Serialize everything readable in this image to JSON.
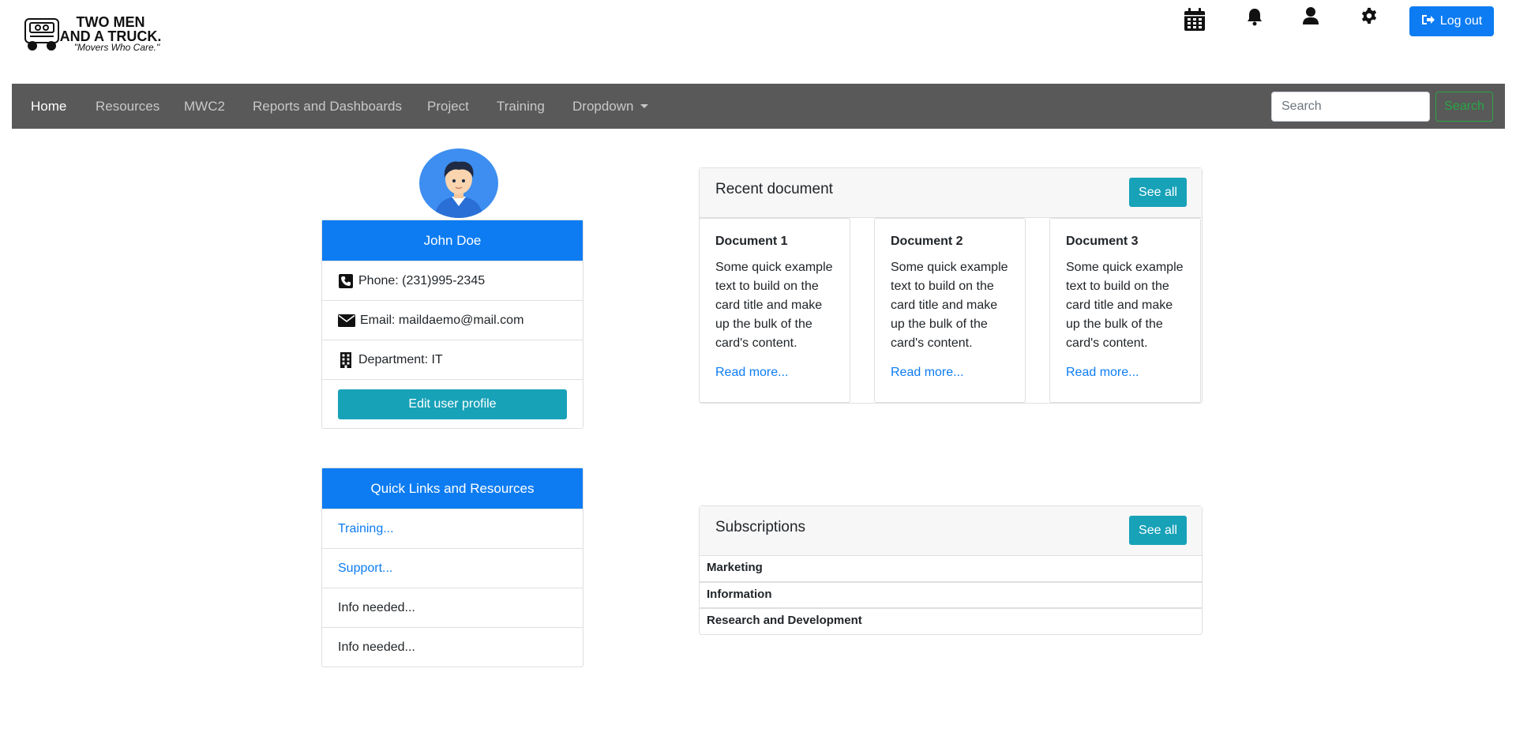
{
  "header": {
    "logo_line1": "TWO MEN",
    "logo_line2": "AND A TRUCK.",
    "logo_tagline": "\"Movers Who Care.\"",
    "icons": [
      "calendar-icon",
      "bell-icon",
      "user-icon",
      "gear-icon"
    ],
    "logout_label": "Log out"
  },
  "nav": {
    "items": [
      {
        "label": "Home",
        "active": true
      },
      {
        "label": "Resources"
      },
      {
        "label": "MWC2"
      },
      {
        "label": "Reports and Dashboards"
      },
      {
        "label": "Project"
      },
      {
        "label": "Training"
      },
      {
        "label": "Dropdown"
      }
    ],
    "search_placeholder": "Search",
    "search_button": "Search"
  },
  "profile": {
    "name": "John Doe",
    "phone": "Phone: (231)995-2345",
    "email": "Email: maildaemo@mail.com",
    "department": "Department: IT",
    "edit_label": "Edit user profile"
  },
  "quick_links": {
    "title": "Quick Links and Resources",
    "items": [
      {
        "label": "Training...",
        "is_link": true
      },
      {
        "label": "Support...",
        "is_link": true
      },
      {
        "label": "Info needed...",
        "is_link": false
      },
      {
        "label": "Info needed...",
        "is_link": false
      }
    ]
  },
  "recent_documents": {
    "title": "Recent document",
    "see_all": "See all",
    "docs": [
      {
        "title": "Document 1",
        "text": "Some quick example text to build on the card title and make up the bulk of the card's content.",
        "link": "Read more..."
      },
      {
        "title": "Document 2",
        "text": "Some quick example text to build on the card title and make up the bulk of the card's content.",
        "link": "Read more..."
      },
      {
        "title": "Document 3",
        "text": "Some quick example text to build on the card title and make up the bulk of the card's content.",
        "link": "Read more..."
      }
    ]
  },
  "subscriptions": {
    "title": "Subscriptions",
    "see_all": "See all",
    "items": [
      "Marketing",
      "Information",
      "Research and Development"
    ]
  },
  "colors": {
    "primary": "#0d7cf2",
    "info": "#17a2b8",
    "success": "#28a745",
    "navbar": "#595959"
  }
}
